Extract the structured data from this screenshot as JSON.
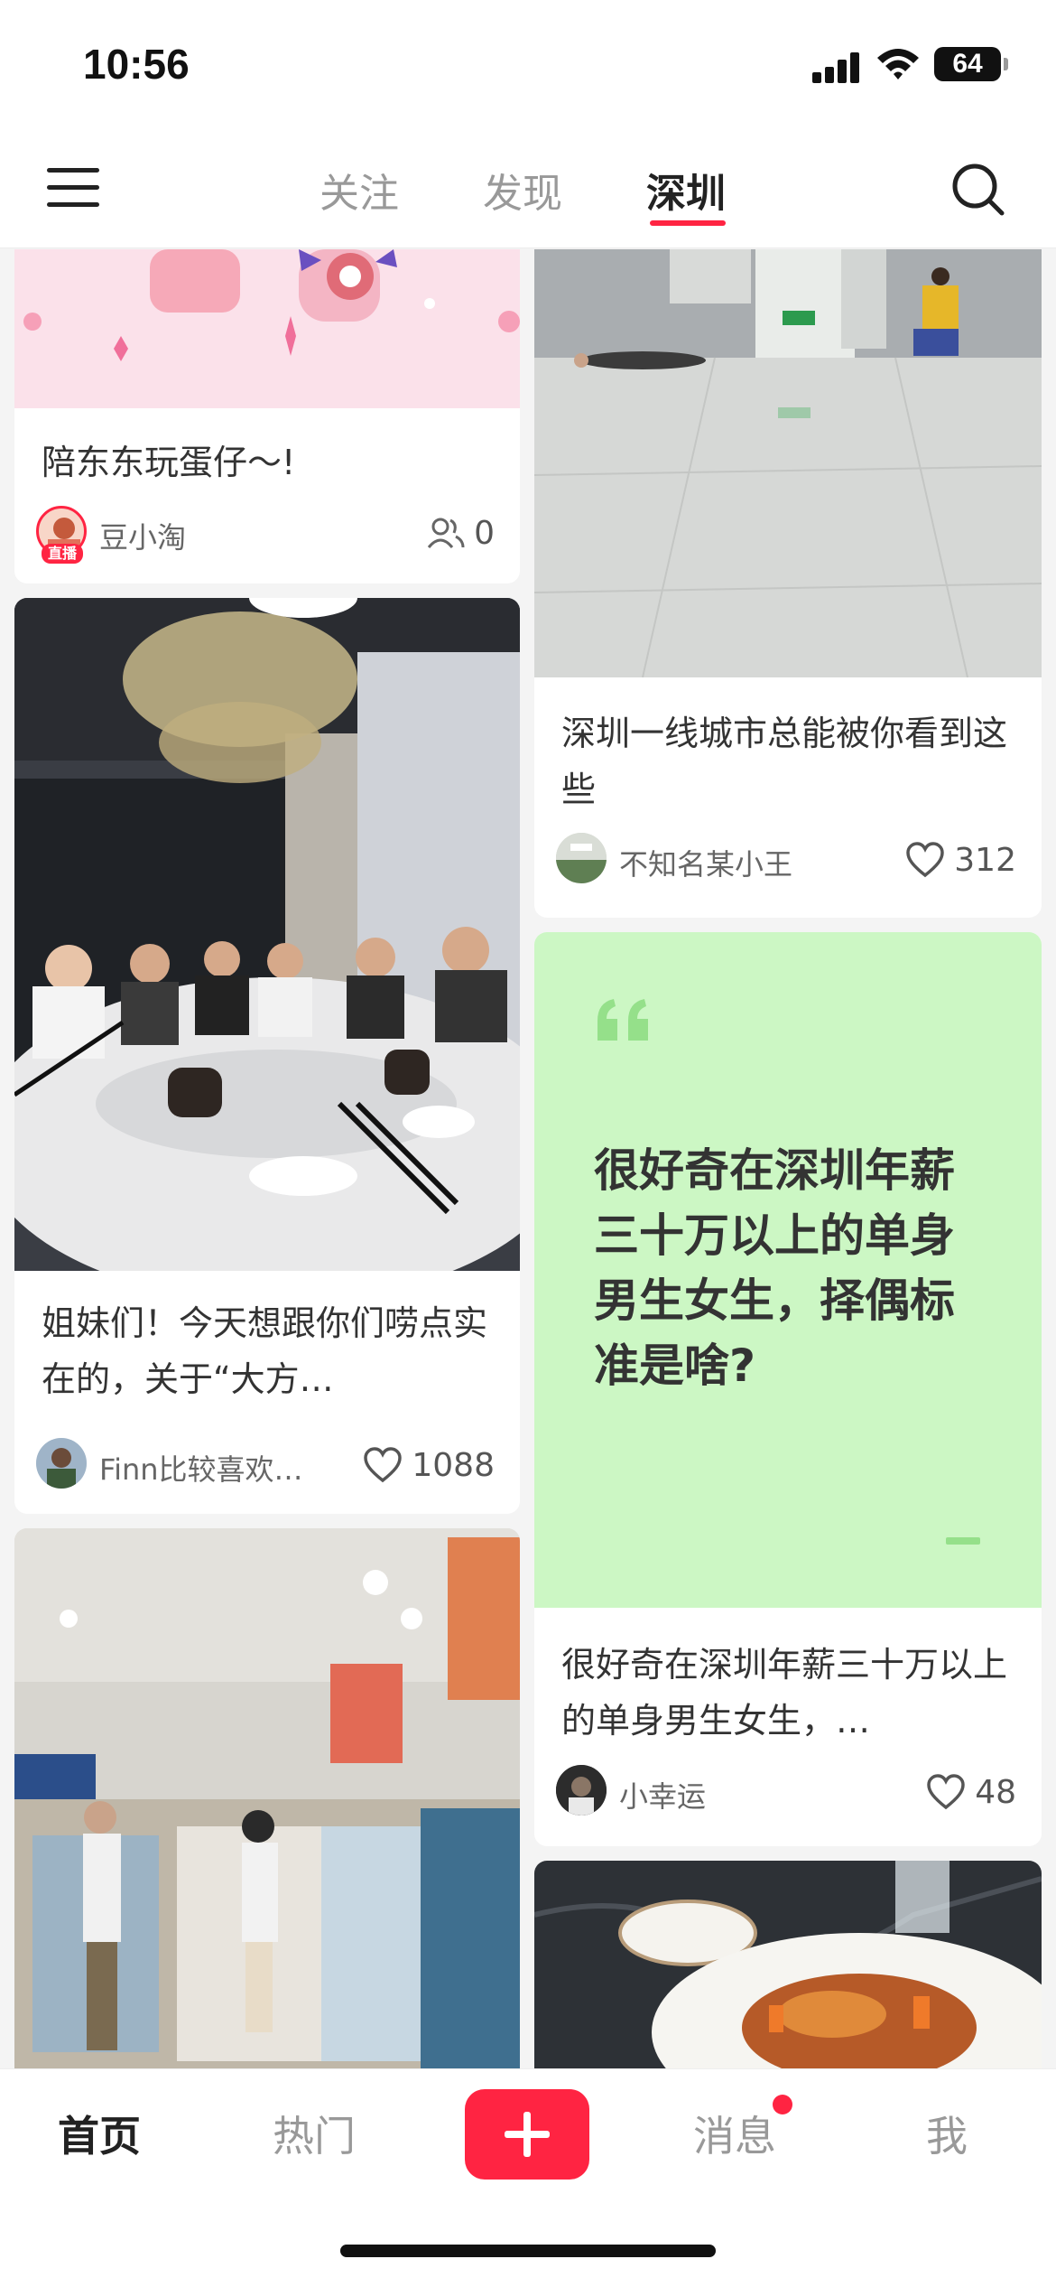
{
  "status_bar": {
    "time": "10:56",
    "battery": "64"
  },
  "header": {
    "tabs": [
      {
        "label": "关注"
      },
      {
        "label": "发现"
      },
      {
        "label": "深圳"
      }
    ],
    "active_tab": "深圳"
  },
  "feed": {
    "left": [
      {
        "title": "陪东东玩蛋仔～!",
        "author": "豆小淘",
        "count": "0",
        "count_icon": "viewers-icon",
        "live_badge": "直播"
      },
      {
        "title": "姐妹们！今天想跟你们唠点实在的，关于“大方…",
        "author": "Finn比较喜欢…",
        "count": "1088",
        "count_icon": "heart-icon"
      },
      {
        "title": ""
      }
    ],
    "right": [
      {
        "title": "深圳一线城市总能被你看到这些",
        "author": "不知名某小王",
        "count": "312",
        "count_icon": "heart-icon"
      },
      {
        "quote_text": "很好奇在深圳年薪三十万以上的单身男生女生，择偶标准是啥?",
        "title": "很好奇在深圳年薪三十万以上的单身男生女生，…",
        "author": "小幸运",
        "count": "48",
        "count_icon": "heart-icon"
      },
      {
        "title": ""
      }
    ]
  },
  "bottom_nav": {
    "items": [
      {
        "label": "首页"
      },
      {
        "label": "热门"
      },
      {
        "label": "消息"
      },
      {
        "label": "我"
      }
    ],
    "active": "首页"
  },
  "colors": {
    "accent": "#ff2442",
    "quote_bg": "#ccf7c4"
  }
}
